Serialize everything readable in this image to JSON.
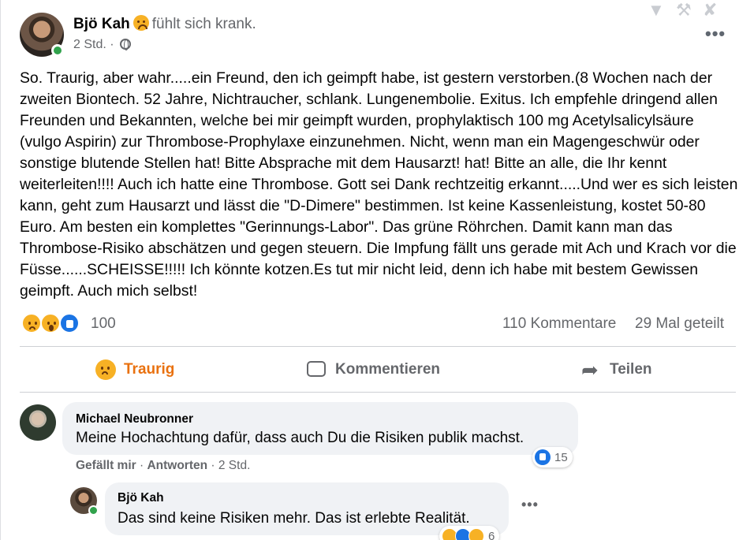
{
  "post": {
    "author": "Bjö Kah",
    "feeling": "fühlt sich krank.",
    "time": "2 Std. ·",
    "text": "So. Traurig, aber wahr.....ein Freund, den ich geimpft habe, ist gestern verstorben.(8 Wochen nach der zweiten Biontech. 52 Jahre, Nichtraucher, schlank. Lungenembolie. Exitus. Ich empfehle dringend allen Freunden und Bekannten, welche bei mir geimpft wurden, prophylaktisch 100 mg Acetylsalicylsäure (vulgo Aspirin) zur Thrombose-Prophylaxe einzunehmen. Nicht, wenn man ein Magengeschwür oder sonstige blutende Stellen hat! Bitte Absprache mit dem Hausarzt! hat! Bitte an alle, die Ihr kennt weiterleiten!!!! Auch ich hatte eine Thrombose. Gott sei Dank rechtzeitig erkannt.....Und wer es sich leisten kann, geht zum Hausarzt und lässt die \"D-Dimere\" bestimmen. Ist keine Kassenleistung, kostet 50-80 Euro. Am besten ein komplettes \"Gerinnungs-Labor\". Das grüne Röhrchen. Damit kann man das Thrombose-Risiko abschätzen und gegen steuern. Die Impfung fällt uns gerade mit Ach und Krach vor die Füsse......SCHEISSE!!!!! Ich könnte kotzen.Es tut mir nicht leid, denn ich habe mit bestem Gewissen geimpft. Auch mich selbst!",
    "reaction_count": "100",
    "comments_count": "110 Kommentare",
    "shares_count": "29 Mal geteilt"
  },
  "actions": {
    "reaction_label": "Traurig",
    "comment_label": "Kommentieren",
    "share_label": "Teilen"
  },
  "comments": [
    {
      "author": "Michael Neubronner",
      "text": "Meine Hochachtung dafür, dass auch Du die Risiken publik machst.",
      "reactions": "15",
      "like_label": "Gefällt mir",
      "reply_label": "Antworten",
      "time": "· 2 Std."
    },
    {
      "author": "Bjö Kah",
      "text": "Das sind keine Risiken mehr. Das ist erlebte Realität.",
      "reactions": "6"
    }
  ],
  "icons": {
    "top_tools": [
      "filter-icon",
      "wrench-icon",
      "tools-icon"
    ],
    "more": "more-options-icon"
  },
  "colors": {
    "reaction_active": "#e9710f",
    "like_blue": "#1b74e4",
    "emoji_yellow": "#f7b125",
    "online_green": "#31a24c",
    "secondary_text": "#65676b",
    "comment_bubble": "#f0f2f5"
  }
}
